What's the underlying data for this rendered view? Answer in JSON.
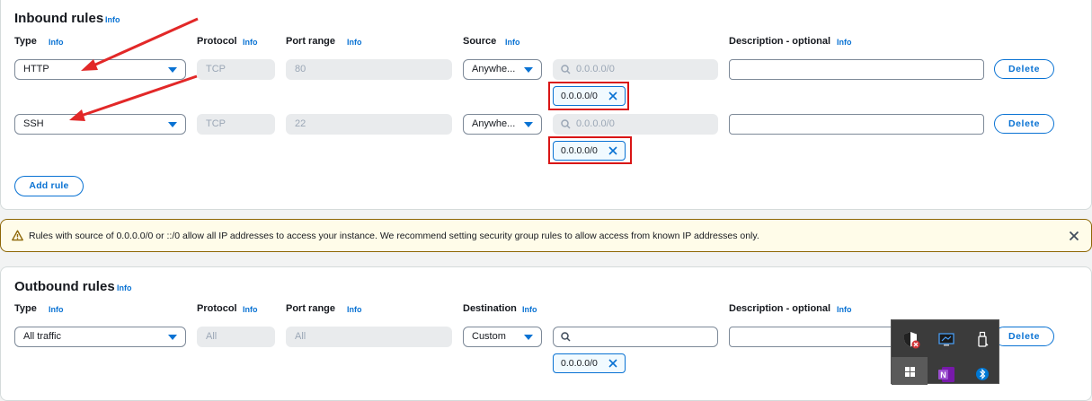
{
  "inbound": {
    "title": "Inbound rules",
    "title_info": "Info",
    "headers": {
      "type": "Type",
      "type_info": "Info",
      "protocol": "Protocol",
      "protocol_info": "Info",
      "port": "Port range",
      "port_info": "Info",
      "source": "Source",
      "source_info": "Info",
      "description": "Description - optional",
      "description_info": "Info"
    },
    "rules": [
      {
        "type": "HTTP",
        "protocol": "TCP",
        "port": "80",
        "source": "Anywhe...",
        "search_placeholder": "0.0.0.0/0",
        "token": "0.0.0.0/0",
        "delete": "Delete"
      },
      {
        "type": "SSH",
        "protocol": "TCP",
        "port": "22",
        "source": "Anywhe...",
        "search_placeholder": "0.0.0.0/0",
        "token": "0.0.0.0/0",
        "delete": "Delete"
      }
    ],
    "add_rule": "Add rule"
  },
  "warning": {
    "text": "Rules with source of 0.0.0.0/0 or ::/0 allow all IP addresses to access your instance. We recommend setting security group rules to allow access from known IP addresses only."
  },
  "outbound": {
    "title": "Outbound rules",
    "title_info": "Info",
    "headers": {
      "type": "Type",
      "type_info": "Info",
      "protocol": "Protocol",
      "protocol_info": "Info",
      "port": "Port range",
      "port_info": "Info",
      "destination": "Destination",
      "destination_info": "Info",
      "description": "Description - optional",
      "description_info": "Info"
    },
    "rules": [
      {
        "type": "All traffic",
        "protocol": "All",
        "port": "All",
        "destination": "Custom",
        "search_value": "",
        "token": "0.0.0.0/0",
        "delete": "Delete"
      }
    ]
  },
  "tray": {
    "icons": [
      "security-shield-icon",
      "display-icon",
      "usb-drive-icon",
      "windows-start-icon",
      "onenote-icon",
      "bluetooth-icon"
    ]
  },
  "colors": {
    "accent": "#0972d3",
    "annotation_red": "#d91515",
    "warning_bg": "#fffce9"
  }
}
